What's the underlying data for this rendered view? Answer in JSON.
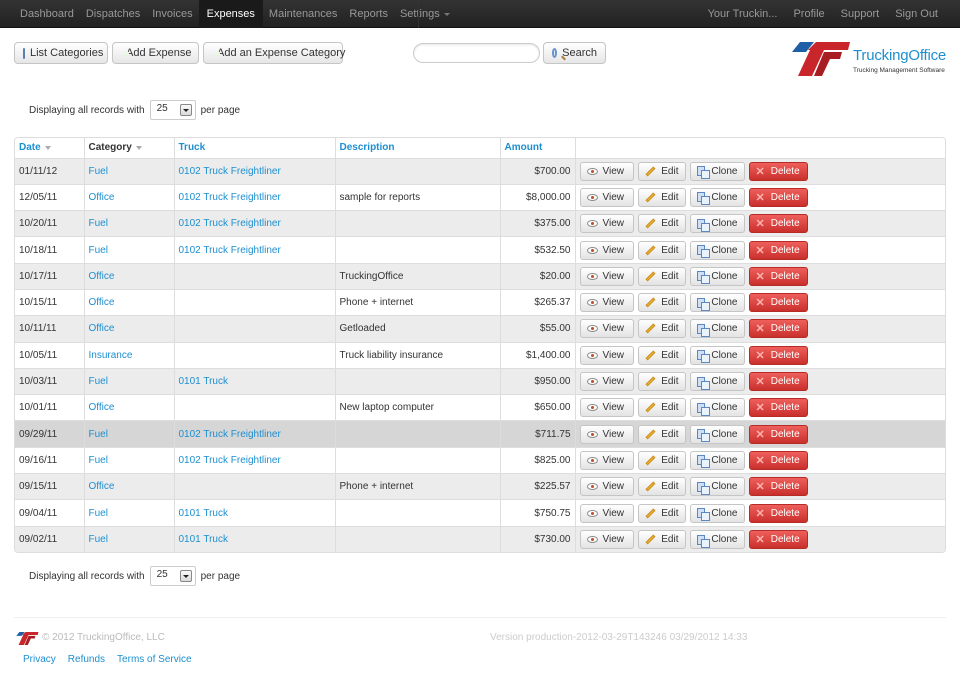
{
  "navbar": {
    "left": [
      {
        "label": "Dashboard",
        "active": false
      },
      {
        "label": "Dispatches",
        "active": false
      },
      {
        "label": "Invoices",
        "active": false
      },
      {
        "label": "Expenses",
        "active": true
      },
      {
        "label": "Maintenances",
        "active": false
      },
      {
        "label": "Reports",
        "active": false
      },
      {
        "label": "Settings",
        "active": false,
        "dropdown": true
      }
    ],
    "right": [
      {
        "label": "Your Truckin..."
      },
      {
        "label": "Profile"
      },
      {
        "label": "Support"
      },
      {
        "label": "Sign Out"
      }
    ]
  },
  "toolbar": {
    "list_categories": "List Categories",
    "add_expense": "Add Expense",
    "add_category": "Add an Expense Category",
    "search_value": "",
    "search_placeholder": "",
    "search_button": "Search"
  },
  "brand": {
    "name": "TruckingOffice",
    "tagline": "Trucking Management Software",
    "colors": {
      "blue": "#1d8fd0",
      "red": "#c9302c"
    }
  },
  "pagination": {
    "prefix": "Displaying all records with",
    "per_page": "25",
    "suffix": "per page"
  },
  "table": {
    "headers": [
      "Date",
      "Category",
      "Truck",
      "Description",
      "Amount",
      ""
    ],
    "actions": {
      "view": "View",
      "edit": "Edit",
      "clone": "Clone",
      "delete": "Delete"
    },
    "rows": [
      {
        "date": "01/11/12",
        "category": "Fuel",
        "truck": "0102 Truck Freightliner",
        "description": "",
        "amount": "$700.00"
      },
      {
        "date": "12/05/11",
        "category": "Office",
        "truck": "0102 Truck Freightliner",
        "description": "sample for reports",
        "amount": "$8,000.00"
      },
      {
        "date": "10/20/11",
        "category": "Fuel",
        "truck": "0102 Truck Freightliner",
        "description": "",
        "amount": "$375.00"
      },
      {
        "date": "10/18/11",
        "category": "Fuel",
        "truck": "0102 Truck Freightliner",
        "description": "",
        "amount": "$532.50"
      },
      {
        "date": "10/17/11",
        "category": "Office",
        "truck": "",
        "description": "TruckingOffice",
        "amount": "$20.00"
      },
      {
        "date": "10/15/11",
        "category": "Office",
        "truck": "",
        "description": "Phone + internet",
        "amount": "$265.37"
      },
      {
        "date": "10/11/11",
        "category": "Office",
        "truck": "",
        "description": "Getloaded",
        "amount": "$55.00"
      },
      {
        "date": "10/05/11",
        "category": "Insurance",
        "truck": "",
        "description": "Truck liability insurance",
        "amount": "$1,400.00"
      },
      {
        "date": "10/03/11",
        "category": "Fuel",
        "truck": "0101 Truck",
        "description": "",
        "amount": "$950.00"
      },
      {
        "date": "10/01/11",
        "category": "Office",
        "truck": "",
        "description": "New laptop computer",
        "amount": "$650.00"
      },
      {
        "date": "09/29/11",
        "category": "Fuel",
        "truck": "0102 Truck Freightliner",
        "description": "",
        "amount": "$711.75",
        "hover": true
      },
      {
        "date": "09/16/11",
        "category": "Fuel",
        "truck": "0102 Truck Freightliner",
        "description": "",
        "amount": "$825.00"
      },
      {
        "date": "09/15/11",
        "category": "Office",
        "truck": "",
        "description": "Phone + internet",
        "amount": "$225.57"
      },
      {
        "date": "09/04/11",
        "category": "Fuel",
        "truck": "0101 Truck",
        "description": "",
        "amount": "$750.75"
      },
      {
        "date": "09/02/11",
        "category": "Fuel",
        "truck": "0101 Truck",
        "description": "",
        "amount": "$730.00"
      }
    ]
  },
  "footer": {
    "copyright": "© 2012 TruckingOffice, LLC",
    "version": "Version production-2012-03-29T143246 03/29/2012 14:33",
    "links": [
      "Privacy",
      "Refunds",
      "Terms of Service"
    ]
  }
}
